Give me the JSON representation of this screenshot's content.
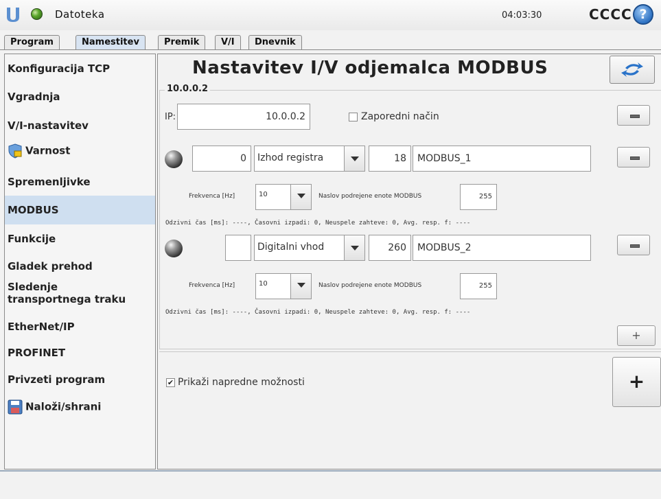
{
  "header": {
    "file_label": "Datoteka",
    "time": "04:03:30",
    "robot_name": "CCCC",
    "help_symbol": "?"
  },
  "tabs": [
    {
      "label": "Program"
    },
    {
      "label": "Namestitev"
    },
    {
      "label": "Premik"
    },
    {
      "label": "V/I"
    },
    {
      "label": "Dnevnik"
    }
  ],
  "sidebar": {
    "items": [
      {
        "label": "Konfiguracija TCP"
      },
      {
        "label": "Vgradnja"
      },
      {
        "label": "V/I-nastavitev"
      },
      {
        "label": "Varnost"
      },
      {
        "label": "Spremenljivke"
      },
      {
        "label": "MODBUS"
      },
      {
        "label": "Funkcije"
      },
      {
        "label": "Gladek prehod"
      },
      {
        "label": "Sledenje transportnega traku"
      },
      {
        "label": "EtherNet/IP"
      },
      {
        "label": "PROFINET"
      },
      {
        "label": "Privzeti program"
      },
      {
        "label": "Naloži/shrani"
      }
    ]
  },
  "main": {
    "title": "Nastavitev I/V odjemalca MODBUS",
    "group_title": "10.0.0.2",
    "ip_label": "IP:",
    "ip_value": "10.0.0.2",
    "sequential_label": "Zaporedni način",
    "signals": [
      {
        "address_value": "0",
        "type": "Izhod registra",
        "number": "18",
        "name": "MODBUS_1",
        "freq_label": "Frekvenca [Hz]",
        "freq_value": "10",
        "slave_label": "Naslov podrejene enote MODBUS",
        "slave_value": "255",
        "stats": "Odzivni čas [ms]: ----, Časovni izpadi: 0, Neuspele zahteve: 0, Avg. resp. f: ----"
      },
      {
        "address_value": "",
        "type": "Digitalni vhod",
        "number": "260",
        "name": "MODBUS_2",
        "freq_label": "Frekvenca [Hz]",
        "freq_value": "10",
        "slave_label": "Naslov podrejene enote MODBUS",
        "slave_value": "255",
        "stats": "Odzivni čas [ms]: ----, Časovni izpadi: 0, Neuspele zahteve: 0, Avg. resp. f: ----"
      }
    ],
    "advanced_label": "Prikaži napredne možnosti",
    "advanced_checked": "✔",
    "add_signal_symbol": "+",
    "add_unit_symbol": "+"
  }
}
